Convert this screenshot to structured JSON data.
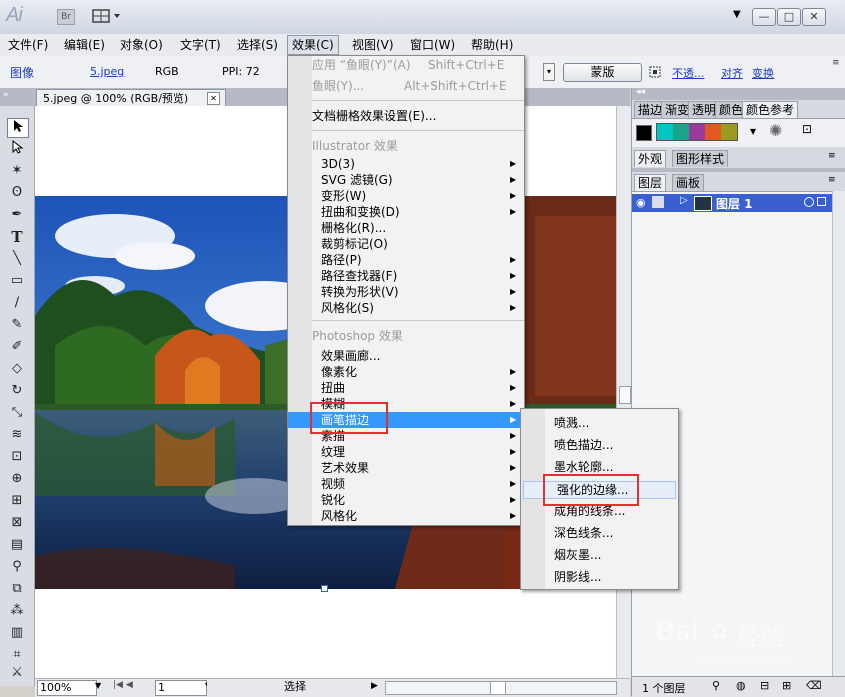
{
  "titlebar": {
    "app_logo": "Ai",
    "bridge_label": "Br",
    "minimize": "—",
    "maximize": "□",
    "close": "✕",
    "dropdown_arrow": "▼"
  },
  "menubar": {
    "items": [
      "文件(F)",
      "编辑(E)",
      "对象(O)",
      "文字(T)",
      "选择(S)",
      "效果(C)",
      "视图(V)",
      "窗口(W)",
      "帮助(H)"
    ]
  },
  "control_bar": {
    "type_label": "图像",
    "file_name": "5.jpeg",
    "color_mode": "RGB",
    "ppi": "PPI: 72",
    "mask_button": "蒙版",
    "opacity_link": "不透...",
    "align_link": "对齐",
    "transform_link": "变换"
  },
  "document_tab": {
    "title": "5.jpeg @ 100% (RGB/预览)",
    "close": "✕"
  },
  "status_bar": {
    "zoom": "100%",
    "page": "1",
    "tool_label": "选择"
  },
  "right_panel": {
    "swatch_tabs": [
      "描边",
      "渐变",
      "透明",
      "颜色",
      "颜色参考"
    ],
    "appearance_tabs": [
      "外观",
      "图形样式"
    ],
    "layer_tabs": [
      "图层",
      "画板"
    ],
    "layer_name": "图层 1",
    "layer_count": "1 个图层",
    "swatch_colors": [
      "#00c8c0",
      "#18a58c",
      "#9a3a9a",
      "#e05a20",
      "#9a9a20"
    ],
    "layer_color": "#3a5fd0"
  },
  "effect_menu": {
    "top_items": [
      {
        "label": "应用 “鱼眼(Y)”(A)",
        "shortcut": "Shift+Ctrl+E",
        "disabled": true
      },
      {
        "label": "鱼眼(Y)...",
        "shortcut": "Alt+Shift+Ctrl+E",
        "disabled": true
      }
    ],
    "raster_settings": "文档栅格效果设置(E)...",
    "illustrator_header": "Illustrator 效果",
    "illustrator_items": [
      "3D(3)",
      "SVG 滤镜(G)",
      "变形(W)",
      "扭曲和变换(D)",
      "栅格化(R)...",
      "裁剪标记(O)",
      "路径(P)",
      "路径查找器(F)",
      "转换为形状(V)",
      "风格化(S)"
    ],
    "photoshop_header": "Photoshop 效果",
    "photoshop_items": [
      "效果画廊...",
      "像素化",
      "扭曲",
      "模糊",
      "画笔描边",
      "素描",
      "纹理",
      "艺术效果",
      "视频",
      "锐化",
      "风格化"
    ]
  },
  "brush_submenu": {
    "items": [
      "喷溅...",
      "喷色描边...",
      "墨水轮廓...",
      "强化的边缘...",
      "成角的线条...",
      "深色线条...",
      "烟灰墨...",
      "阴影线..."
    ]
  },
  "watermark": {
    "brand": "Bai",
    "brand_cn": "经验",
    "url": "jingyan.baidu.com"
  },
  "accent_color": "#3399ff",
  "highlight_box_color": "#e03030"
}
